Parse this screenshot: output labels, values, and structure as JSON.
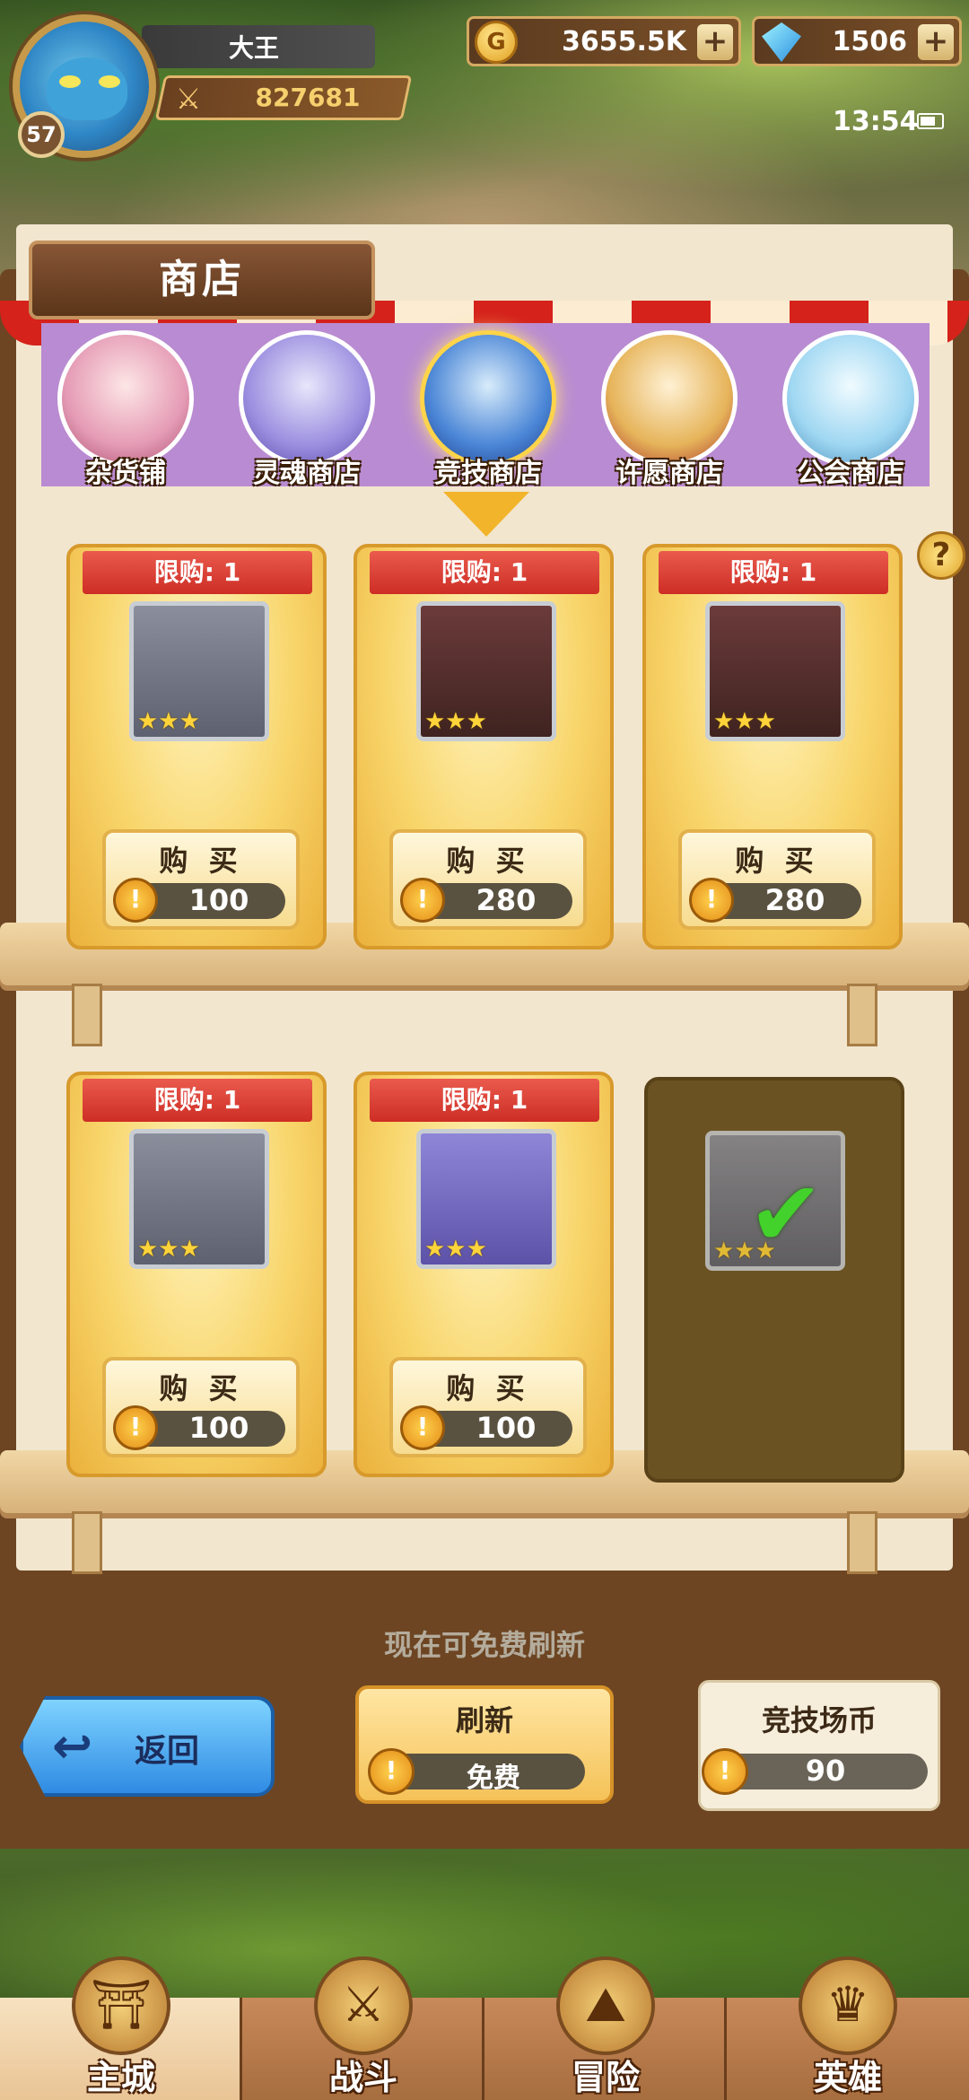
{
  "player": {
    "name": "大王",
    "level": "57",
    "power": "827681"
  },
  "currency": {
    "gold": "3655.5K",
    "gems": "1506",
    "plus": "+"
  },
  "status": {
    "time": "13:54"
  },
  "shop": {
    "title": "商店",
    "help": "?"
  },
  "tabs": [
    {
      "label": "杂货铺"
    },
    {
      "label": "灵魂商店"
    },
    {
      "label": "竞技商店"
    },
    {
      "label": "许愿商店"
    },
    {
      "label": "公会商店"
    }
  ],
  "items": [
    {
      "limit": "限购: 1",
      "stars": "★★★",
      "buy": "购 买",
      "price": "100",
      "icon": "gauntlets-icon"
    },
    {
      "limit": "限购: 1",
      "stars": "★★★",
      "buy": "购 买",
      "price": "280",
      "icon": "helmet-icon"
    },
    {
      "limit": "限购: 1",
      "stars": "★★★",
      "buy": "购 买",
      "price": "280",
      "icon": "ring-icon"
    },
    {
      "limit": "限购: 1",
      "stars": "★★★",
      "buy": "购 买",
      "price": "100",
      "icon": "helmet-icon"
    },
    {
      "limit": "限购: 1",
      "stars": "★★★",
      "buy": "购 买",
      "price": "100",
      "icon": "gloves-icon"
    },
    {
      "stars": "★★★",
      "icon": "axe-icon",
      "sold": true
    }
  ],
  "footer": {
    "free_note": "现在可免费刷新",
    "back": "返回",
    "refresh": "刷新",
    "refresh_cost": "免费",
    "arena_label": "竞技场币",
    "arena_value": "90",
    "coin_glyph": "!"
  },
  "nav": [
    {
      "label": "主城"
    },
    {
      "label": "战斗"
    },
    {
      "label": "冒险"
    },
    {
      "label": "英雄"
    }
  ]
}
